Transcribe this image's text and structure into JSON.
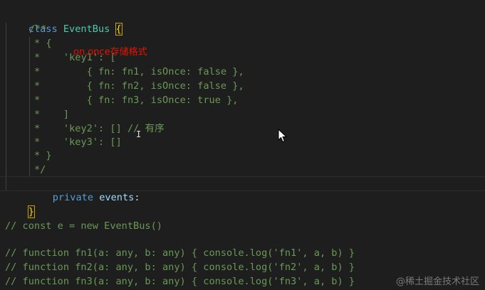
{
  "code": {
    "class_keyword": "class",
    "class_name": "EventBus",
    "open_brace": "{",
    "close_brace": "}",
    "comment_lines": [
      "/**",
      "* {",
      "*    'key1': [",
      "*        { fn: fn1, isOnce: false },",
      "*        { fn: fn2, isOnce: false },",
      "*        { fn: fn3, isOnce: true },",
      "*    ]",
      "*    'key2': [] // 有序",
      "*    'key3': []",
      "* }",
      "*/"
    ],
    "private_keyword": "private",
    "field_name": "events",
    "field_colon": ":",
    "comment_instance": "// const e = new EventBus()",
    "comment_fn_lines": [
      "// function fn1(a: any, b: any) { console.log('fn1', a, b) }",
      "// function fn2(a: any, b: any) { console.log('fn2', a, b) }",
      "// function fn3(a: any, b: any) { console.log('fn3', a, b) }"
    ]
  },
  "annotation": {
    "text": "on,once存储格式",
    "color": "#e51400"
  },
  "watermark": "@稀土掘金技术社区",
  "colors": {
    "background": "#1e1e1e",
    "keyword": "#569cd6",
    "class_name": "#4ec9b0",
    "comment": "#6a9955",
    "variable": "#9cdcfe"
  }
}
